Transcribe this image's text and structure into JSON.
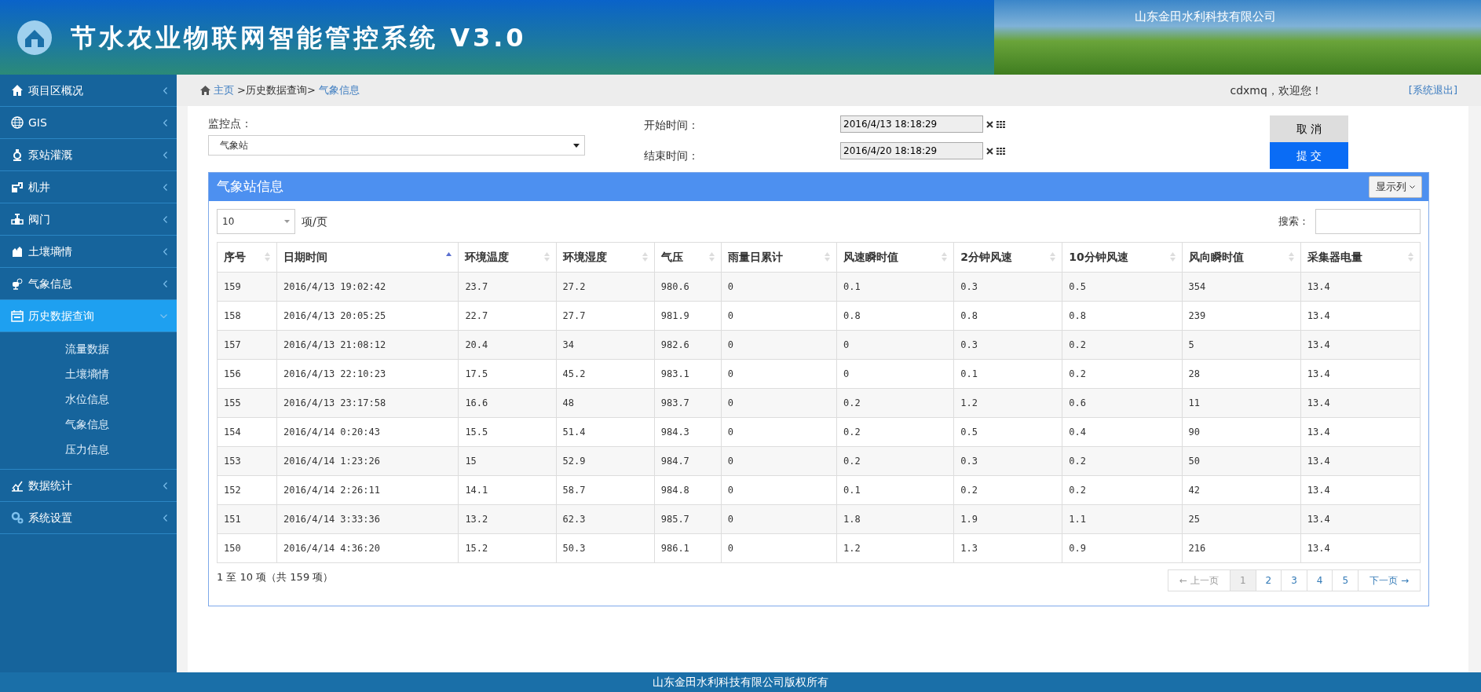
{
  "header": {
    "title": "节水农业物联网智能管控系统 V3.0",
    "company": "山东金田水利科技有限公司"
  },
  "sidebar": {
    "items": [
      {
        "label": "项目区概况",
        "selected": false,
        "expanded": false
      },
      {
        "label": "GIS",
        "selected": false,
        "expanded": false
      },
      {
        "label": "泵站灌溉",
        "selected": false,
        "expanded": false
      },
      {
        "label": "机井",
        "selected": false,
        "expanded": false
      },
      {
        "label": "阀门",
        "selected": false,
        "expanded": false
      },
      {
        "label": "土壤墒情",
        "selected": false,
        "expanded": false
      },
      {
        "label": "气象信息",
        "selected": false,
        "expanded": false
      },
      {
        "label": "历史数据查询",
        "selected": true,
        "expanded": true,
        "children": [
          {
            "label": "流量数据"
          },
          {
            "label": "土壤墒情"
          },
          {
            "label": "水位信息"
          },
          {
            "label": "气象信息"
          },
          {
            "label": "压力信息"
          }
        ]
      },
      {
        "label": "数据统计",
        "selected": false,
        "expanded": false
      },
      {
        "label": "系统设置",
        "selected": false,
        "expanded": false
      }
    ]
  },
  "breadcrumb": [
    {
      "label": "主页",
      "kind": "link"
    },
    {
      "label": ">历史数据查询>",
      "kind": "text"
    },
    {
      "label": "气象信息",
      "kind": "link"
    }
  ],
  "user": {
    "greeting": "cdxmq，欢迎您！",
    "logout": "[系统退出]"
  },
  "form": {
    "station_label": "监控点：",
    "station_value": "气象站",
    "start_label": "开始时间：",
    "start_value": "2016/4/13 18:18:29",
    "end_label": "结束时间：",
    "end_value": "2016/4/20 18:18:29",
    "cancel": "取 消",
    "submit": "提 交"
  },
  "panel": {
    "title": "气象站信息",
    "columns_button": "显示列",
    "page_size": "10",
    "page_size_label": "项/页",
    "search_label": "搜索："
  },
  "table": {
    "columns": [
      {
        "label": "序号",
        "sorted": false
      },
      {
        "label": "日期时间",
        "sorted": true
      },
      {
        "label": "环境温度",
        "sorted": false
      },
      {
        "label": "环境湿度",
        "sorted": false
      },
      {
        "label": "气压",
        "sorted": false
      },
      {
        "label": "雨量日累计",
        "sorted": false
      },
      {
        "label": "风速瞬时值",
        "sorted": false
      },
      {
        "label": "2分钟风速",
        "sorted": false
      },
      {
        "label": "10分钟风速",
        "sorted": false
      },
      {
        "label": "风向瞬时值",
        "sorted": false
      },
      {
        "label": "采集器电量",
        "sorted": false
      }
    ],
    "rows": [
      [
        "159",
        "2016/4/13 19:02:42",
        "23.7",
        "27.2",
        "980.6",
        "0",
        "0.1",
        "0.3",
        "0.5",
        "354",
        "13.4"
      ],
      [
        "158",
        "2016/4/13 20:05:25",
        "22.7",
        "27.7",
        "981.9",
        "0",
        "0.8",
        "0.8",
        "0.8",
        "239",
        "13.4"
      ],
      [
        "157",
        "2016/4/13 21:08:12",
        "20.4",
        "34",
        "982.6",
        "0",
        "0",
        "0.3",
        "0.2",
        "5",
        "13.4"
      ],
      [
        "156",
        "2016/4/13 22:10:23",
        "17.5",
        "45.2",
        "983.1",
        "0",
        "0",
        "0.1",
        "0.2",
        "28",
        "13.4"
      ],
      [
        "155",
        "2016/4/13 23:17:58",
        "16.6",
        "48",
        "983.7",
        "0",
        "0.2",
        "1.2",
        "0.6",
        "11",
        "13.4"
      ],
      [
        "154",
        "2016/4/14 0:20:43",
        "15.5",
        "51.4",
        "984.3",
        "0",
        "0.2",
        "0.5",
        "0.4",
        "90",
        "13.4"
      ],
      [
        "153",
        "2016/4/14 1:23:26",
        "15",
        "52.9",
        "984.7",
        "0",
        "0.2",
        "0.3",
        "0.2",
        "50",
        "13.4"
      ],
      [
        "152",
        "2016/4/14 2:26:11",
        "14.1",
        "58.7",
        "984.8",
        "0",
        "0.1",
        "0.2",
        "0.2",
        "42",
        "13.4"
      ],
      [
        "151",
        "2016/4/14 3:33:36",
        "13.2",
        "62.3",
        "985.7",
        "0",
        "1.8",
        "1.9",
        "1.1",
        "25",
        "13.4"
      ],
      [
        "150",
        "2016/4/14 4:36:20",
        "15.2",
        "50.3",
        "986.1",
        "0",
        "1.2",
        "1.3",
        "0.9",
        "216",
        "13.4"
      ]
    ]
  },
  "info": "1 至 10 项（共 159 项）",
  "pagination": [
    {
      "label": "← 上一页",
      "kind": "prev",
      "disabled": true,
      "selected": false
    },
    {
      "label": "1",
      "kind": "page",
      "disabled": false,
      "selected": true
    },
    {
      "label": "2",
      "kind": "page",
      "disabled": false,
      "selected": false
    },
    {
      "label": "3",
      "kind": "page",
      "disabled": false,
      "selected": false
    },
    {
      "label": "4",
      "kind": "page",
      "disabled": false,
      "selected": false
    },
    {
      "label": "5",
      "kind": "page",
      "disabled": false,
      "selected": false
    },
    {
      "label": "下一页 →",
      "kind": "next",
      "disabled": false,
      "selected": false
    }
  ],
  "footer": "山东金田水利科技有限公司版权所有"
}
